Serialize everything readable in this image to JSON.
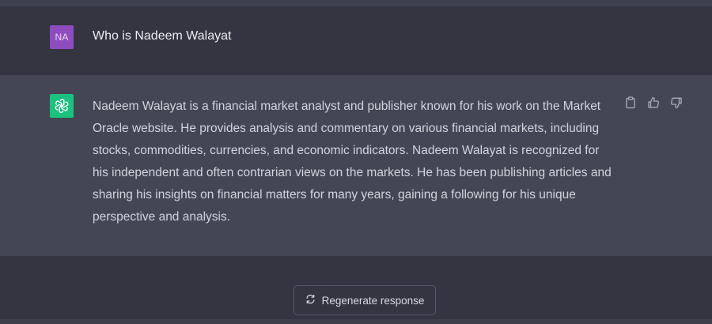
{
  "user_message": {
    "avatar_initials": "NA",
    "text": "Who is Nadeem Walayat"
  },
  "assistant_message": {
    "avatar_icon": "openai-logo-icon",
    "text": "Nadeem Walayat is a financial market analyst and publisher known for his work on the Market Oracle website. He provides analysis and commentary on various financial markets, including stocks, commodities, currencies, and economic indicators. Nadeem Walayat is recognized for his independent and often contrarian views on the markets. He has been publishing articles and sharing his insights on financial matters for many years, gaining a following for his unique perspective and analysis.",
    "actions": [
      "copy-icon",
      "thumbs-up-icon",
      "thumbs-down-icon"
    ]
  },
  "regenerate": {
    "label": "Regenerate response",
    "icon": "refresh-icon"
  },
  "colors": {
    "background": "#343541",
    "assistant_background": "#444654",
    "user_avatar": "#8e4dbf",
    "bot_avatar": "#19c37d",
    "text": "#d1d5db"
  }
}
